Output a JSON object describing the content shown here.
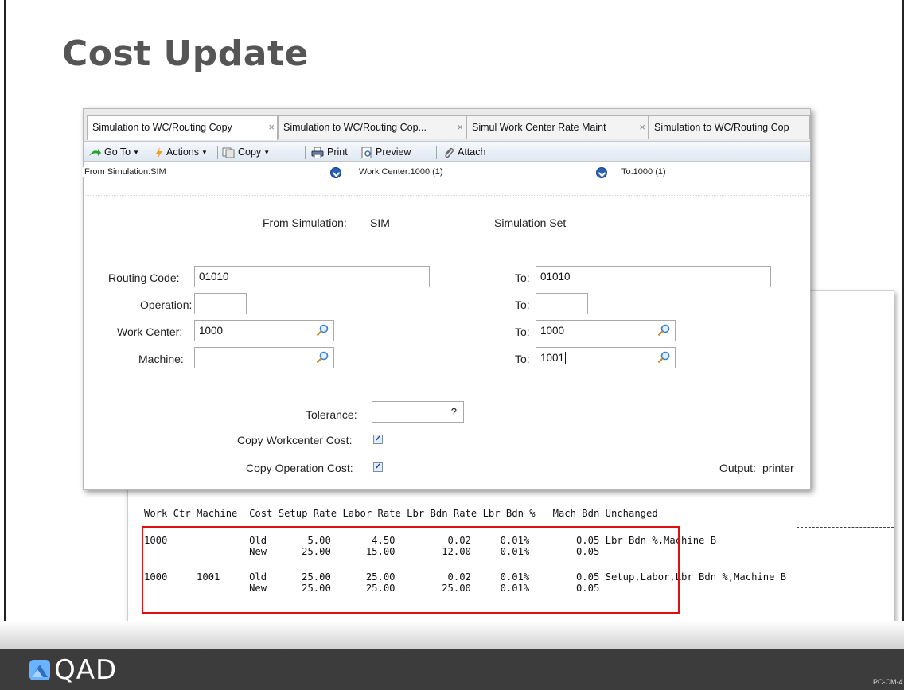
{
  "slide": {
    "title": "Cost Update",
    "code": "PC-CM-4"
  },
  "logo": {
    "text": "QAD"
  },
  "window": {
    "tabs": [
      {
        "label": "Simulation to WC/Routing Copy"
      },
      {
        "label": "Simulation to WC/Routing Cop..."
      },
      {
        "label": "Simul Work Center Rate Maint"
      },
      {
        "label": "Simulation to WC/Routing Cop"
      }
    ],
    "toolbar": {
      "goto": "Go To",
      "actions": "Actions",
      "copy": "Copy",
      "print": "Print",
      "preview": "Preview",
      "attach": "Attach"
    },
    "path": {
      "from": "From Simulation:SIM",
      "workcenter": "Work Center:1000 (1)",
      "to": "To:1000 (1)"
    },
    "form": {
      "from_simulation_label": "From Simulation:",
      "from_simulation_value": "SIM",
      "simulation_set_label": "Simulation Set",
      "routing_code_label": "Routing Code:",
      "routing_code": "01010",
      "routing_code_to": "01010",
      "operation_label": "Operation:",
      "operation": "",
      "operation_to": "",
      "work_center_label": "Work Center:",
      "work_center": "1000",
      "work_center_to": "1000",
      "machine_label": "Machine:",
      "machine": "",
      "machine_to": "1001",
      "to_label": "To:",
      "tolerance_label": "Tolerance:",
      "tolerance_value": "?",
      "copy_wc_cost_label": "Copy Workcenter Cost:",
      "copy_wc_cost": true,
      "copy_op_cost_label": "Copy Operation Cost:",
      "copy_op_cost": true,
      "output_label": "Output:",
      "output_value": "printer"
    }
  },
  "report": {
    "header": "Work Ctr Machine  Cost Setup Rate Labor Rate Lbr Bdn Rate Lbr Bdn %   Mach Bdn Unchanged",
    "rows": [
      {
        "line1": "1000              Old       5.00       4.50         0.02     0.01%        0.05 Lbr Bdn %,Machine B",
        "line2": "                  New      25.00      15.00        12.00     0.01%        0.05"
      },
      {
        "line1": "1000     1001     Old      25.00      25.00         0.02     0.01%        0.05 Setup,Labor,Lbr Bdn %,Machine B",
        "line2": "                  New      25.00      25.00        25.00     0.01%        0.05"
      }
    ]
  }
}
